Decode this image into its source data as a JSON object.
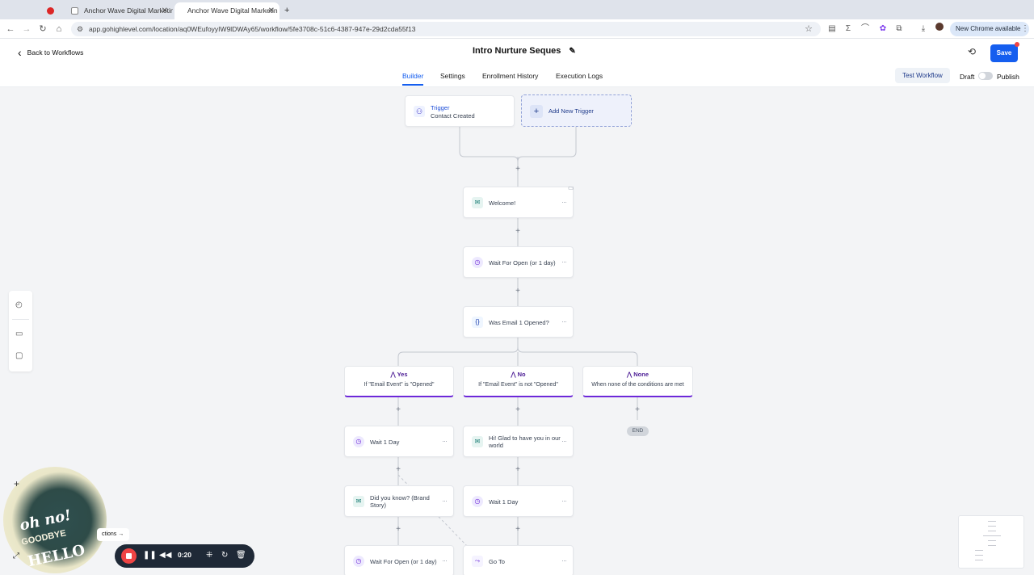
{
  "browser": {
    "tabs": [
      {
        "title": ""
      },
      {
        "title": "Anchor Wave Digital Marketin"
      },
      {
        "title": "Anchor Wave Digital Marketin"
      }
    ],
    "new_tab": "+",
    "url": "app.gohighlevel.com/location/aq0WEufoyyIW9lDWAy65/workflow/5fe3708c-51c6-4387-947e-29d2cda55f13",
    "update_pill": "New Chrome available"
  },
  "header": {
    "back_label": "Back to Workflows",
    "workflow_title": "Intro Nurture Seques",
    "save_label": "Save",
    "tabs": [
      "Builder",
      "Settings",
      "Enrollment History",
      "Execution Logs"
    ],
    "test_label": "Test Workflow",
    "draft_label": "Draft",
    "publish_label": "Publish"
  },
  "canvas": {
    "trigger": {
      "title": "Trigger",
      "subtitle": "Contact Created"
    },
    "add_trigger": "Add New Trigger",
    "nodes": {
      "welcome": "Welcome!",
      "wait_open_1": "Wait For Open (or 1 day)",
      "condition": "Was Email 1 Opened?",
      "wait_1_day_a": "Wait 1 Day",
      "glad": "Hi! Glad to have you in our world",
      "did_you_know": "Did you know? (Brand Story)",
      "wait_1_day_b": "Wait 1 Day",
      "wait_open_2": "Wait For Open (or 1 day)",
      "goto": "Go To"
    },
    "branches": [
      {
        "title": "Yes",
        "subtitle": "If \"Email Event\" is \"Opened\""
      },
      {
        "title": "No",
        "subtitle": "If \"Email Event\" is not \"Opened\""
      },
      {
        "title": "None",
        "subtitle": "When none of the conditions are met"
      }
    ],
    "end_label": "END"
  },
  "overlay": {
    "actions_label": "ctions",
    "timer": "0:20",
    "sticker_lines": [
      "oh no!",
      "GOODBYE",
      "HELLO"
    ]
  }
}
